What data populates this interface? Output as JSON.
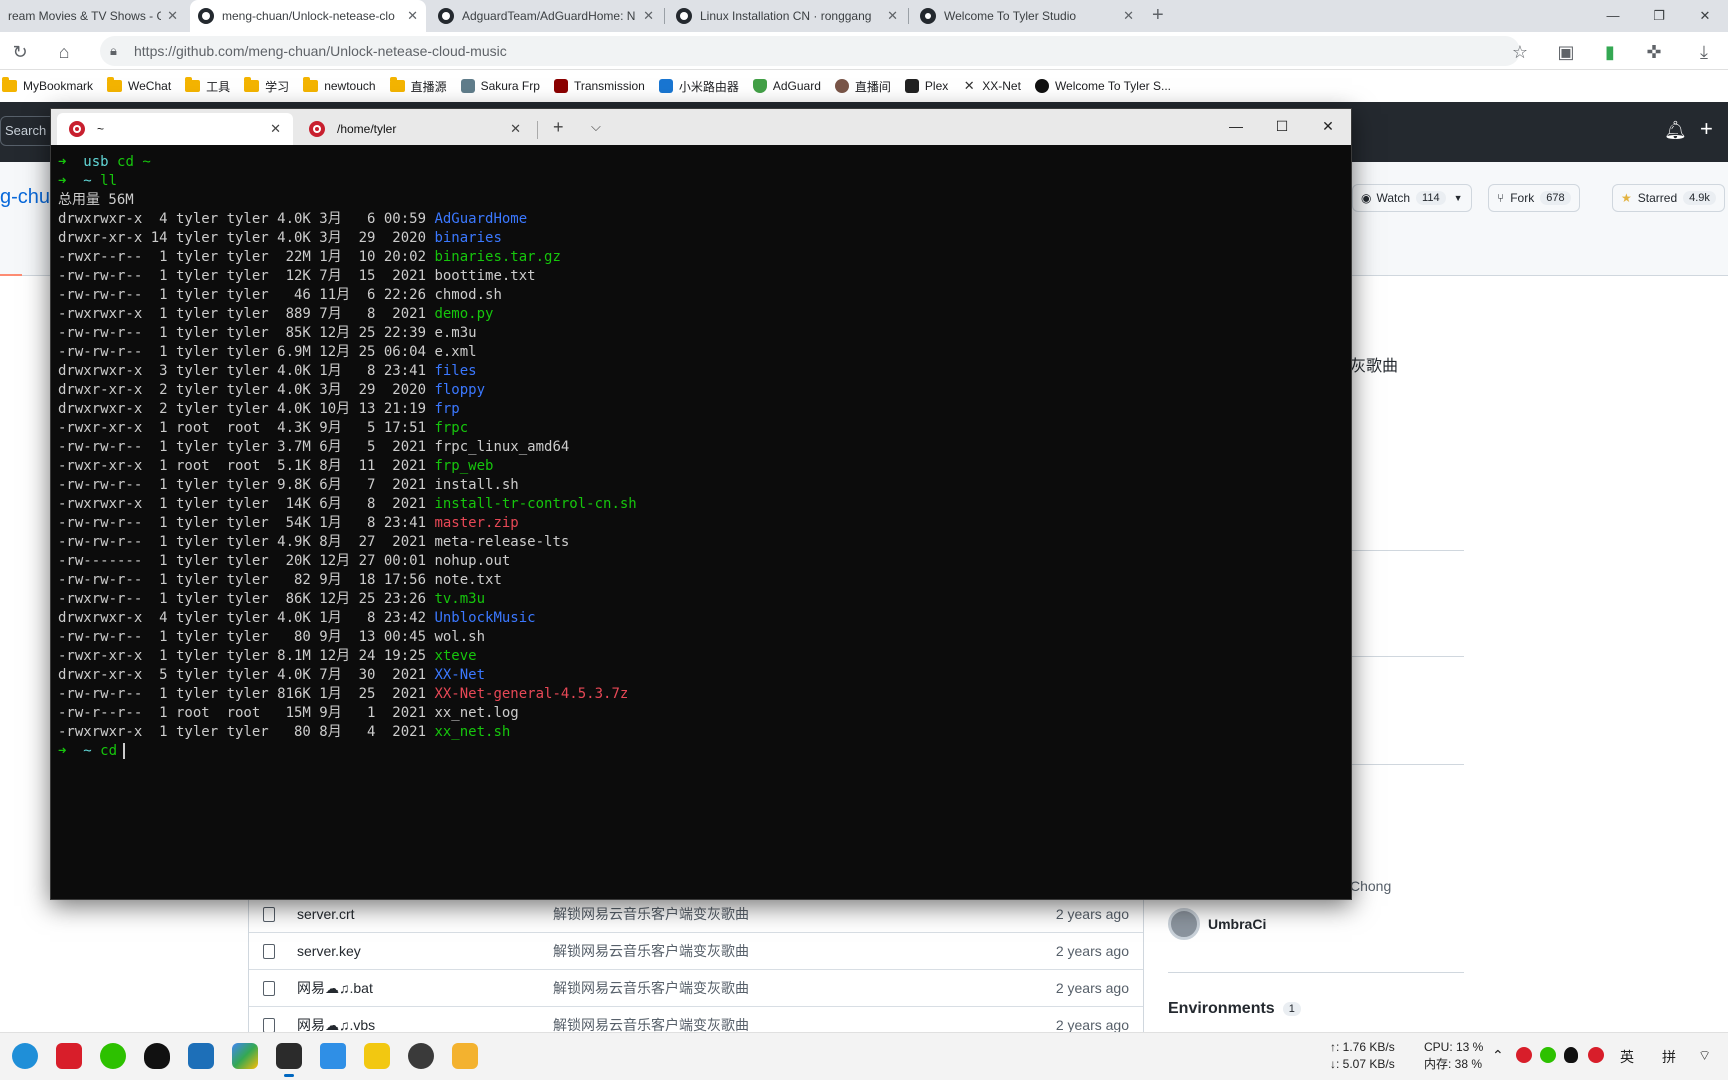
{
  "browser": {
    "tabs": [
      {
        "title": "ream Movies & TV Shows - Go",
        "active": false
      },
      {
        "title": "meng-chuan/Unlock-netease-clo",
        "active": true
      },
      {
        "title": "AdguardTeam/AdGuardHome: N",
        "active": false
      },
      {
        "title": "Linux Installation CN · ronggang",
        "active": false
      },
      {
        "title": "Welcome To Tyler Studio",
        "active": false
      }
    ],
    "url": "https://github.com/meng-chuan/Unlock-netease-cloud-music",
    "bookmarks": [
      {
        "label": "MyBookmark",
        "kind": "folder"
      },
      {
        "label": "WeChat",
        "kind": "folder"
      },
      {
        "label": "工具",
        "kind": "folder"
      },
      {
        "label": "学习",
        "kind": "folder"
      },
      {
        "label": "newtouch",
        "kind": "folder"
      },
      {
        "label": "直播源",
        "kind": "folder"
      },
      {
        "label": "Sakura Frp",
        "kind": "site",
        "color": "#607d8b"
      },
      {
        "label": "Transmission",
        "kind": "site",
        "color": "#8b0000"
      },
      {
        "label": "小米路由器",
        "kind": "site",
        "color": "#1976d2"
      },
      {
        "label": "AdGuard",
        "kind": "site",
        "color": "#43a047"
      },
      {
        "label": "直播间",
        "kind": "site",
        "color": "#795548"
      },
      {
        "label": "Plex",
        "kind": "site",
        "color": "#e5a00d"
      },
      {
        "label": "XX-Net",
        "kind": "site",
        "color": "#333333"
      },
      {
        "label": "Welcome To Tyler S...",
        "kind": "site",
        "color": "#111111"
      }
    ]
  },
  "github": {
    "search_text": "Search o",
    "repo_name_fragment": "g-chu",
    "watch_label": "Watch",
    "watch_count": "114",
    "fork_label": "Fork",
    "fork_count": "678",
    "star_label": "Starred",
    "star_count": "4.9k",
    "desc_fragment": "灰歌曲",
    "contributor_fragment": "Chong",
    "contributor": "UmbraCi",
    "environments_label": "Environments",
    "environments_count": "1",
    "files": [
      {
        "name": "server.crt",
        "message": "解锁网易云音乐客户端变灰歌曲",
        "age": "2 years ago"
      },
      {
        "name": "server.key",
        "message": "解锁网易云音乐客户端变灰歌曲",
        "age": "2 years ago"
      },
      {
        "name": "网易☁♫.bat",
        "message": "解锁网易云音乐客户端变灰歌曲",
        "age": "2 years ago"
      },
      {
        "name": "网易☁♫.vbs",
        "message": "解锁网易云音乐客户端变灰歌曲",
        "age": "2 years ago"
      }
    ]
  },
  "terminal": {
    "tabs": [
      {
        "title": "~",
        "active": true
      },
      {
        "title": "/home/tyler",
        "active": false
      }
    ],
    "lines": [
      {
        "type": "prompt",
        "dir": "usb",
        "cmd": "cd ~"
      },
      {
        "type": "prompt",
        "dir": "~",
        "cmd": "ll"
      },
      {
        "type": "text",
        "text": "总用量 56M"
      },
      {
        "type": "entry",
        "meta": "drwxrwxr-x  4 tyler tyler 4.0K 3月   6 00:59 ",
        "name": "AdGuardHome",
        "color": "blue"
      },
      {
        "type": "entry",
        "meta": "drwxr-xr-x 14 tyler tyler 4.0K 3月  29  2020 ",
        "name": "binaries",
        "color": "blue"
      },
      {
        "type": "entry",
        "meta": "-rwxr--r--  1 tyler tyler  22M 1月  10 20:02 ",
        "name": "binaries.tar.gz",
        "color": "green"
      },
      {
        "type": "entry",
        "meta": "-rw-rw-r--  1 tyler tyler  12K 7月  15  2021 ",
        "name": "boottime.txt",
        "color": "white"
      },
      {
        "type": "entry",
        "meta": "-rw-rw-r--  1 tyler tyler   46 11月  6 22:26 ",
        "name": "chmod.sh",
        "color": "white"
      },
      {
        "type": "entry",
        "meta": "-rwxrwxr-x  1 tyler tyler  889 7月   8  2021 ",
        "name": "demo.py",
        "color": "green"
      },
      {
        "type": "entry",
        "meta": "-rw-rw-r--  1 tyler tyler  85K 12月 25 22:39 ",
        "name": "e.m3u",
        "color": "white"
      },
      {
        "type": "entry",
        "meta": "-rw-rw-r--  1 tyler tyler 6.9M 12月 25 06:04 ",
        "name": "e.xml",
        "color": "white"
      },
      {
        "type": "entry",
        "meta": "drwxrwxr-x  3 tyler tyler 4.0K 1月   8 23:41 ",
        "name": "files",
        "color": "blue"
      },
      {
        "type": "entry",
        "meta": "drwxr-xr-x  2 tyler tyler 4.0K 3月  29  2020 ",
        "name": "floppy",
        "color": "blue"
      },
      {
        "type": "entry",
        "meta": "drwxrwxr-x  2 tyler tyler 4.0K 10月 13 21:19 ",
        "name": "frp",
        "color": "blue"
      },
      {
        "type": "entry",
        "meta": "-rwxr-xr-x  1 root  root  4.3K 9月   5 17:51 ",
        "name": "frpc",
        "color": "green"
      },
      {
        "type": "entry",
        "meta": "-rw-rw-r--  1 tyler tyler 3.7M 6月   5  2021 ",
        "name": "frpc_linux_amd64",
        "color": "white"
      },
      {
        "type": "entry",
        "meta": "-rwxr-xr-x  1 root  root  5.1K 8月  11  2021 ",
        "name": "frp_web",
        "color": "green"
      },
      {
        "type": "entry",
        "meta": "-rw-rw-r--  1 tyler tyler 9.8K 6月   7  2021 ",
        "name": "install.sh",
        "color": "white"
      },
      {
        "type": "entry",
        "meta": "-rwxrwxr-x  1 tyler tyler  14K 6月   8  2021 ",
        "name": "install-tr-control-cn.sh",
        "color": "green"
      },
      {
        "type": "entry",
        "meta": "-rw-rw-r--  1 tyler tyler  54K 1月   8 23:41 ",
        "name": "master.zip",
        "color": "red"
      },
      {
        "type": "entry",
        "meta": "-rw-rw-r--  1 tyler tyler 4.9K 8月  27  2021 ",
        "name": "meta-release-lts",
        "color": "white"
      },
      {
        "type": "entry",
        "meta": "-rw-------  1 tyler tyler  20K 12月 27 00:01 ",
        "name": "nohup.out",
        "color": "white"
      },
      {
        "type": "entry",
        "meta": "-rw-rw-r--  1 tyler tyler   82 9月  18 17:56 ",
        "name": "note.txt",
        "color": "white"
      },
      {
        "type": "entry",
        "meta": "-rwxrw-r--  1 tyler tyler  86K 12月 25 23:26 ",
        "name": "tv.m3u",
        "color": "green"
      },
      {
        "type": "entry",
        "meta": "drwxrwxr-x  4 tyler tyler 4.0K 1月   8 23:42 ",
        "name": "UnblockMusic",
        "color": "blue"
      },
      {
        "type": "entry",
        "meta": "-rw-rw-r--  1 tyler tyler   80 9月  13 00:45 ",
        "name": "wol.sh",
        "color": "white"
      },
      {
        "type": "entry",
        "meta": "-rwxr-xr-x  1 tyler tyler 8.1M 12月 24 19:25 ",
        "name": "xteve",
        "color": "green"
      },
      {
        "type": "entry",
        "meta": "drwxr-xr-x  5 tyler tyler 4.0K 7月  30  2021 ",
        "name": "XX-Net",
        "color": "blue"
      },
      {
        "type": "entry",
        "meta": "-rw-rw-r--  1 tyler tyler 816K 1月  25  2021 ",
        "name": "XX-Net-general-4.5.3.7z",
        "color": "red"
      },
      {
        "type": "entry",
        "meta": "-rw-r--r--  1 root  root   15M 9月   1  2021 ",
        "name": "xx_net.log",
        "color": "white"
      },
      {
        "type": "entry",
        "meta": "-rwxrwxr-x  1 tyler tyler   80 8月   4  2021 ",
        "name": "xx_net.sh",
        "color": "green"
      },
      {
        "type": "prompt",
        "dir": "~",
        "cmd": "cd",
        "cursor": true
      }
    ]
  },
  "taskbar": {
    "net_up": "↑: 1.76 KB/s",
    "net_down": "↓: 5.07 KB/s",
    "cpu": "CPU: 13 %",
    "mem": "内存: 38 %",
    "ime_lang": "英",
    "ime_mode": "拼"
  }
}
